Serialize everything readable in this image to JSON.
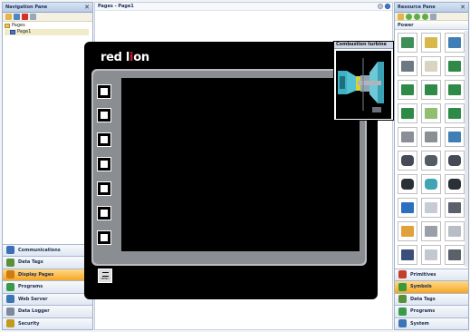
{
  "nav_pane": {
    "title": "Navigation Pane",
    "close": "✕",
    "tree": {
      "root": "Pages",
      "child": "Page1"
    },
    "buttons": [
      {
        "label": "Communications",
        "color": "#3b6fb6"
      },
      {
        "label": "Data Tags",
        "color": "#5a8f3c"
      },
      {
        "label": "Display Pages",
        "color": "#d07a12"
      },
      {
        "label": "Programs",
        "color": "#3b9a4a"
      },
      {
        "label": "Web Server",
        "color": "#3a75b5"
      },
      {
        "label": "Data Logger",
        "color": "#7d8b9c"
      },
      {
        "label": "Security",
        "color": "#c29a1e"
      }
    ],
    "active_button": "Display Pages"
  },
  "editor": {
    "title": "Pages - Page1",
    "device": {
      "brand_prefix": "red l",
      "brand_accent": "i",
      "brand_suffix": "on",
      "menu_label": "MENU"
    }
  },
  "tooltip": {
    "title": "Combustion turbine"
  },
  "resource_pane": {
    "title": "Resource Pane",
    "close": "✕",
    "category": "Power",
    "buttons": [
      {
        "label": "Primitives",
        "color": "#c33d2b"
      },
      {
        "label": "Symbols",
        "color": "#3a9a3a"
      },
      {
        "label": "Data Tags",
        "color": "#5a8f3c"
      },
      {
        "label": "Programs",
        "color": "#3b9a4a"
      },
      {
        "label": "System",
        "color": "#3a75b5"
      }
    ],
    "active_button": "Symbols"
  },
  "colors": {
    "accent_active": "#f5a623",
    "brand_red": "#d41f26"
  }
}
